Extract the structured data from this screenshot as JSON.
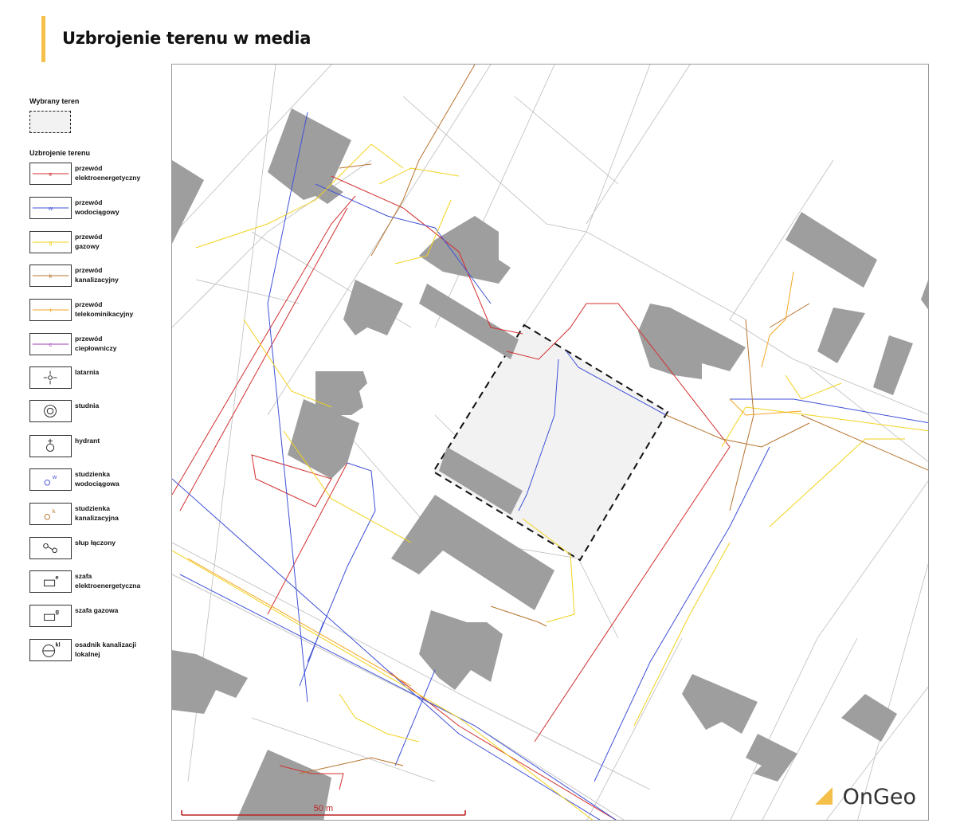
{
  "title": "Uzbrojenie terenu w media",
  "legend": {
    "selected_heading": "Wybrany teren",
    "utilities_heading": "Uzbrojenie terenu",
    "items": [
      {
        "label": "przewód\nelektroenergetyczny",
        "symbol": "e",
        "color": "#d32f2f",
        "kind": "line"
      },
      {
        "label": "przewód\nwodociągowy",
        "symbol": "w",
        "color": "#3f51d8",
        "kind": "line"
      },
      {
        "label": "przewód\ngazowy",
        "symbol": "g",
        "color": "#f2d21b",
        "kind": "line"
      },
      {
        "label": "przewód\nkanalizacyjny",
        "symbol": "k",
        "color": "#b8732e",
        "kind": "line"
      },
      {
        "label": "przewód\ntelekominikacyjny",
        "symbol": "t",
        "color": "#f5a623",
        "kind": "line"
      },
      {
        "label": "przewód\nciepłowniczy",
        "symbol": "c",
        "color": "#9c3bb5",
        "kind": "line"
      },
      {
        "label": "latarnia",
        "symbol": "lamp",
        "color": "#222222",
        "kind": "icon"
      },
      {
        "label": "studnia",
        "symbol": "well",
        "color": "#222222",
        "kind": "icon"
      },
      {
        "label": "hydrant",
        "symbol": "hydrant",
        "color": "#222222",
        "kind": "icon"
      },
      {
        "label": "studzienka\nwodociągowa",
        "symbol": "w",
        "color": "#3f51d8",
        "kind": "manhole"
      },
      {
        "label": "studzienka\nkanalizacyjna",
        "symbol": "k",
        "color": "#b8732e",
        "kind": "manhole"
      },
      {
        "label": "słup łączony",
        "symbol": "pole",
        "color": "#222222",
        "kind": "icon"
      },
      {
        "label": "szafa\nelektroenergetyczna",
        "symbol": "e",
        "color": "#222222",
        "kind": "cabinet"
      },
      {
        "label": "szafa gazowa",
        "symbol": "g",
        "color": "#222222",
        "kind": "cabinet"
      },
      {
        "label": "osadnik kanalizacji\nlokalnej",
        "symbol": "kl",
        "color": "#222222",
        "kind": "tank"
      }
    ]
  },
  "map": {
    "scale_label": "50 m",
    "building_color": "#9e9e9e",
    "selected_fill": "#f2f2f2"
  },
  "brand": "OnGeo"
}
